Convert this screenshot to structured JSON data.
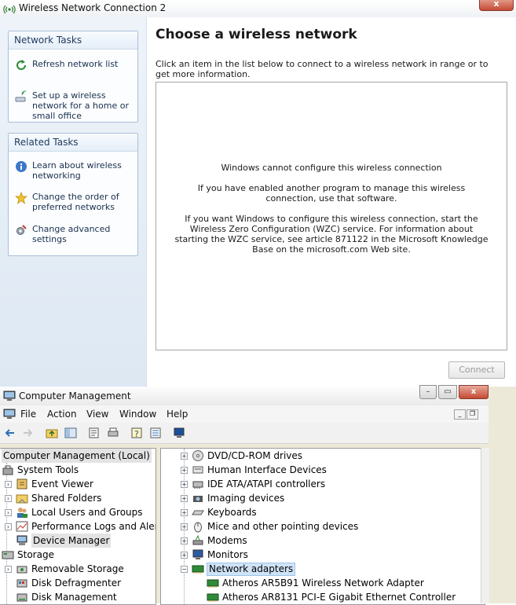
{
  "wnc": {
    "title": "Wireless Network Connection 2",
    "close_glyph": "x",
    "network_tasks": {
      "heading": "Network Tasks",
      "items": [
        {
          "label": "Refresh network list",
          "icon": "refresh-icon"
        },
        {
          "label": "Set up a wireless network for a home or small office",
          "icon": "wireless-setup-icon"
        }
      ]
    },
    "related_tasks": {
      "heading": "Related Tasks",
      "items": [
        {
          "label": "Learn about wireless networking",
          "icon": "info-icon"
        },
        {
          "label": "Change the order of preferred networks",
          "icon": "star-icon"
        },
        {
          "label": "Change advanced settings",
          "icon": "settings-icon"
        }
      ]
    },
    "heading": "Choose a wireless network",
    "instruction": "Click an item in the list below to connect to a wireless network in range or to get more information.",
    "messages": {
      "line1": "Windows cannot configure this wireless connection",
      "line2": "If you have enabled another program to manage this wireless connection, use that software.",
      "line3": "If you want Windows to configure this wireless connection, start the Wireless Zero Configuration (WZC) service. For information about starting the WZC service, see article 871122 in the Microsoft Knowledge Base on the microsoft.com Web site."
    },
    "connect_label": "Connect"
  },
  "cm": {
    "title": "Computer Management",
    "menu": [
      "File",
      "Action",
      "View",
      "Window",
      "Help"
    ],
    "tree": [
      {
        "label": "Computer Management (Local)",
        "icon": "computer-icon"
      },
      {
        "label": "System Tools",
        "icon": "tools-icon"
      },
      {
        "label": "Event Viewer",
        "icon": "event-viewer-icon"
      },
      {
        "label": "Shared Folders",
        "icon": "shared-folder-icon"
      },
      {
        "label": "Local Users and Groups",
        "icon": "users-icon"
      },
      {
        "label": "Performance Logs and Alerts",
        "icon": "performance-icon"
      },
      {
        "label": "Device Manager",
        "icon": "device-manager-icon"
      },
      {
        "label": "Storage",
        "icon": "storage-icon"
      },
      {
        "label": "Removable Storage",
        "icon": "removable-storage-icon"
      },
      {
        "label": "Disk Defragmenter",
        "icon": "defrag-icon"
      },
      {
        "label": "Disk Management",
        "icon": "disk-icon"
      }
    ],
    "devices": [
      {
        "label": "DVD/CD-ROM drives",
        "icon": "dvd-icon"
      },
      {
        "label": "Human Interface Devices",
        "icon": "hid-icon"
      },
      {
        "label": "IDE ATA/ATAPI controllers",
        "icon": "ide-icon"
      },
      {
        "label": "Imaging devices",
        "icon": "camera-icon"
      },
      {
        "label": "Keyboards",
        "icon": "keyboard-icon"
      },
      {
        "label": "Mice and other pointing devices",
        "icon": "mouse-icon"
      },
      {
        "label": "Modems",
        "icon": "modem-icon"
      },
      {
        "label": "Monitors",
        "icon": "monitor-icon"
      },
      {
        "label": "Network adapters",
        "icon": "network-adapter-icon"
      },
      {
        "label": "Atheros AR5B91 Wireless Network Adapter",
        "icon": "network-card-icon"
      },
      {
        "label": "Atheros AR8131 PCI-E Gigabit Ethernet Controller",
        "icon": "network-card-icon"
      }
    ]
  },
  "colors": {
    "sidebar_bg": "#dde8f3",
    "task_text": "#1a2f4d",
    "selection": "#cfe3f7",
    "close_red": "#c44a32"
  }
}
